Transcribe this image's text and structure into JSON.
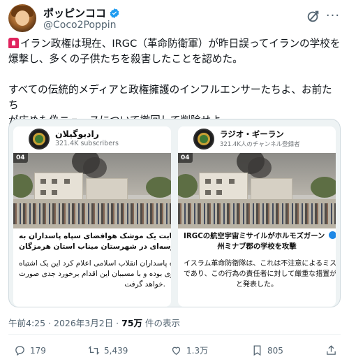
{
  "author": {
    "display_name": "ポッピンココ",
    "handle": "@Coco2Poppin"
  },
  "tweet": {
    "line1": "イラン政権は現在、IRGC（革命防衛軍）が昨日誤ってイランの学校を",
    "line2": "爆撃し、多くの子供たちを殺害したことを認めた。",
    "line3": "すべての伝統的メディアと政権擁護のインフルエンサーたちよ、お前たち",
    "line4": "が広めた偽ニュースについて撤回して削除せよ。"
  },
  "media": {
    "left": {
      "channel": "رادیوگیلان",
      "subscribers": "321.4K subscribers",
      "time": "04",
      "caption_bold_1": "اصابت یک موشک هوافضای سپاه پاسداران به",
      "caption_bold_2": "مدرسه‌ای در شهرستان میناب استان هرمزگان",
      "caption_1": "سپاه پاسداران انقلاب اسلامی اعلام کرد این یک اشتباه",
      "caption_2": "سهوی بوده و با مسببان این اقدام برخورد جدی صورت",
      "caption_3": "خواهد گرفت."
    },
    "right": {
      "channel": "ラジオ・ギーラン",
      "subscribers": "321.4K人のチャンネル登録者",
      "time": "04",
      "caption_bold_1": "IRGCの航空宇宙ミサイルがホルモズガーン",
      "caption_bold_2": "州ミナブ郡の学校を攻撃",
      "caption_1": "イスラム革命防衛隊は、これは不注意によるミス",
      "caption_2": "であり、この行為の責任者に対して厳重な措置が取られる",
      "caption_3": "と発表した。"
    }
  },
  "meta": {
    "timestamp": "午前4:25 · 2026年3月2日 · ",
    "views": "75万",
    "views_suffix": " 件の表示"
  },
  "actions": {
    "replies": "179",
    "reposts": "5,439",
    "likes": "1.3万",
    "bookmarks": "805"
  },
  "colors": {
    "verified": "#1d9bf0",
    "text": "#0f1419",
    "secondary": "#536471"
  }
}
